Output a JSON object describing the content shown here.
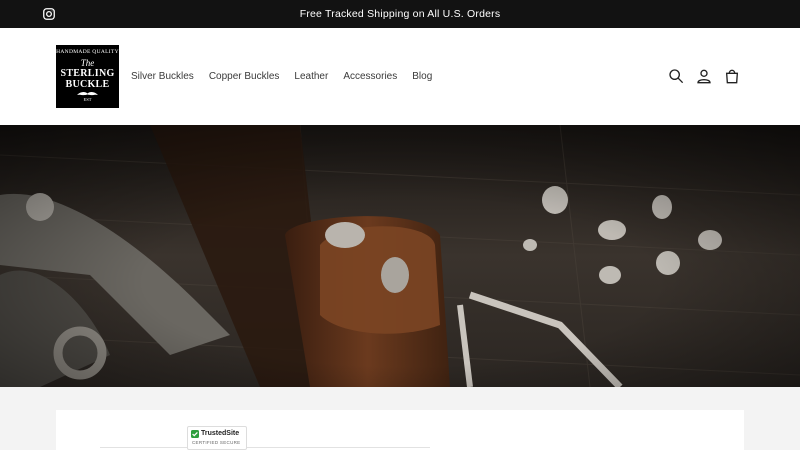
{
  "announcement": {
    "text": "Free Tracked Shipping on All U.S. Orders",
    "social_icon": "instagram-icon"
  },
  "logo": {
    "arc_text": "HANDMADE QUALITY",
    "the": "The",
    "line1": "STERLING",
    "line2": "BUCKLE",
    "est": "EST"
  },
  "nav": {
    "items": [
      {
        "label": "Silver Buckles"
      },
      {
        "label": "Copper Buckles"
      },
      {
        "label": "Leather"
      },
      {
        "label": "Accessories"
      },
      {
        "label": "Blog"
      }
    ]
  },
  "header_icons": [
    "search-icon",
    "account-icon",
    "cart-icon"
  ],
  "trust_badge": {
    "title": "TrustedSite",
    "subtitle": "CERTIFIED SECURE"
  },
  "colors": {
    "announcement_bg": "#121212",
    "header_bg": "#ffffff",
    "page_bg": "#f3f3f3",
    "badge_green": "#2e9e3e"
  }
}
